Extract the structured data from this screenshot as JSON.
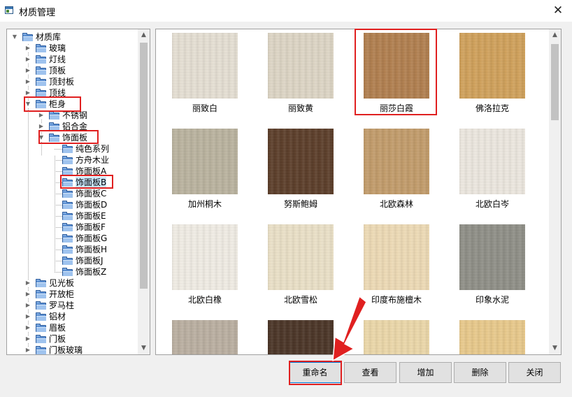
{
  "window": {
    "title": "材质管理",
    "close_glyph": "✕"
  },
  "tree": {
    "items": [
      {
        "label": "材质库"
      },
      {
        "label": "玻璃"
      },
      {
        "label": "灯线"
      },
      {
        "label": "顶板"
      },
      {
        "label": "顶封板"
      },
      {
        "label": "顶线"
      },
      {
        "label": "柜身"
      },
      {
        "label": "不锈钢"
      },
      {
        "label": "铝合金"
      },
      {
        "label": "饰面板"
      },
      {
        "label": "纯色系列"
      },
      {
        "label": "方舟木业"
      },
      {
        "label": "饰面板A"
      },
      {
        "label": "饰面板B",
        "selected": true
      },
      {
        "label": "饰面板C"
      },
      {
        "label": "饰面板D"
      },
      {
        "label": "饰面板E"
      },
      {
        "label": "饰面板F"
      },
      {
        "label": "饰面板G"
      },
      {
        "label": "饰面板H"
      },
      {
        "label": "饰面板J"
      },
      {
        "label": "饰面板Z"
      },
      {
        "label": "见光板"
      },
      {
        "label": "开放柜"
      },
      {
        "label": "罗马柱"
      },
      {
        "label": "铝材"
      },
      {
        "label": "眉板"
      },
      {
        "label": "门板"
      },
      {
        "label": "门板玻璃"
      }
    ]
  },
  "materials": [
    {
      "name": "丽致白",
      "color": "#e4ded2"
    },
    {
      "name": "丽致黄",
      "color": "#dcd4c4"
    },
    {
      "name": "丽莎白霞",
      "color": "#b07e4e"
    },
    {
      "name": "佛洛拉克",
      "color": "#cfa05a"
    },
    {
      "name": "加州桐木",
      "color": "#b9b29e"
    },
    {
      "name": "努斯鲍姆",
      "color": "#5b3d29"
    },
    {
      "name": "北欧森林",
      "color": "#c19b6a"
    },
    {
      "name": "北欧白岑",
      "color": "#ebe6de"
    },
    {
      "name": "北欧白橡",
      "color": "#efebe3"
    },
    {
      "name": "北欧雪松",
      "color": "#e9dfc6"
    },
    {
      "name": "印度布施檀木",
      "color": "#ecd9b4"
    },
    {
      "name": "印象水泥",
      "color": "#8e8e86"
    },
    {
      "name": "",
      "color": "#b9aea0"
    },
    {
      "name": "",
      "color": "#4a3426"
    },
    {
      "name": "",
      "color": "#ead6a8"
    },
    {
      "name": "",
      "color": "#e7c88a"
    }
  ],
  "buttons": {
    "rename": "重命名",
    "view": "查看",
    "add": "增加",
    "delete": "删除",
    "close": "关闭"
  },
  "scroll_glyphs": {
    "up": "▲",
    "down": "▼"
  },
  "colors": {
    "annotation": "#e02020",
    "selection": "#cce8ff",
    "folder": "#5b8fd2"
  }
}
